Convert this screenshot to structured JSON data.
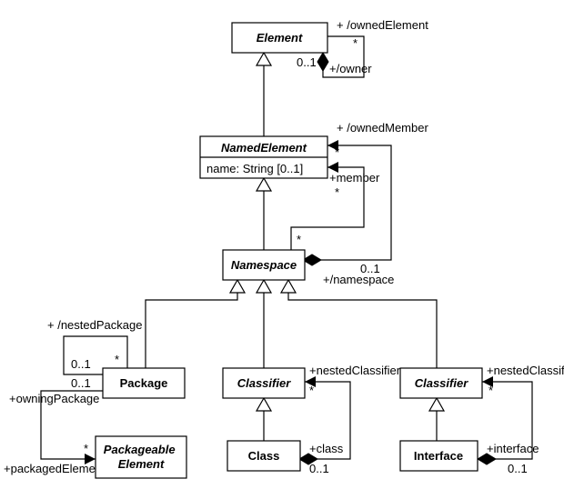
{
  "classes": {
    "element": {
      "name": "Element"
    },
    "namedElement": {
      "name": "NamedElement",
      "attr": "name: String [0..1]"
    },
    "namespace": {
      "name": "Namespace"
    },
    "package": {
      "name": "Package"
    },
    "packageableElement": {
      "name": "Packageable\nElement"
    },
    "classifier1": {
      "name": "Classifier"
    },
    "class": {
      "name": "Class"
    },
    "classifier2": {
      "name": "Classifier"
    },
    "interface": {
      "name": "Interface"
    }
  },
  "labels": {
    "ownedElement": "+ /ownedElement",
    "ownedElementMult": "*",
    "owner": "+/owner",
    "ownerMult": "0..1",
    "ownedMember": "+ /ownedMember",
    "ownedMemberMult": "*",
    "member": "+member",
    "memberMult": "*",
    "namespace": "+/namespace",
    "namespaceMult": "0..1",
    "namespaceMemberMult": "*",
    "nestedPackage": "+ /nestedPackage",
    "nestedPackageMult": "*",
    "nestedPackageOwnMult": "0..1",
    "owningPackage": "+owningPackage",
    "owningPackageMult": "0..1",
    "packagedElement": "+packagedElement",
    "packagedElementMult": "*",
    "nestedClassifier1": "+nestedClassifier",
    "nestedClassifier1Mult": "*",
    "classRole": "+class",
    "classRoleMult": "0..1",
    "nestedClassifier2": "+nestedClassifier",
    "nestedClassifier2Mult": "*",
    "interfaceRole": "+interface",
    "interfaceRoleMult": "0..1"
  }
}
